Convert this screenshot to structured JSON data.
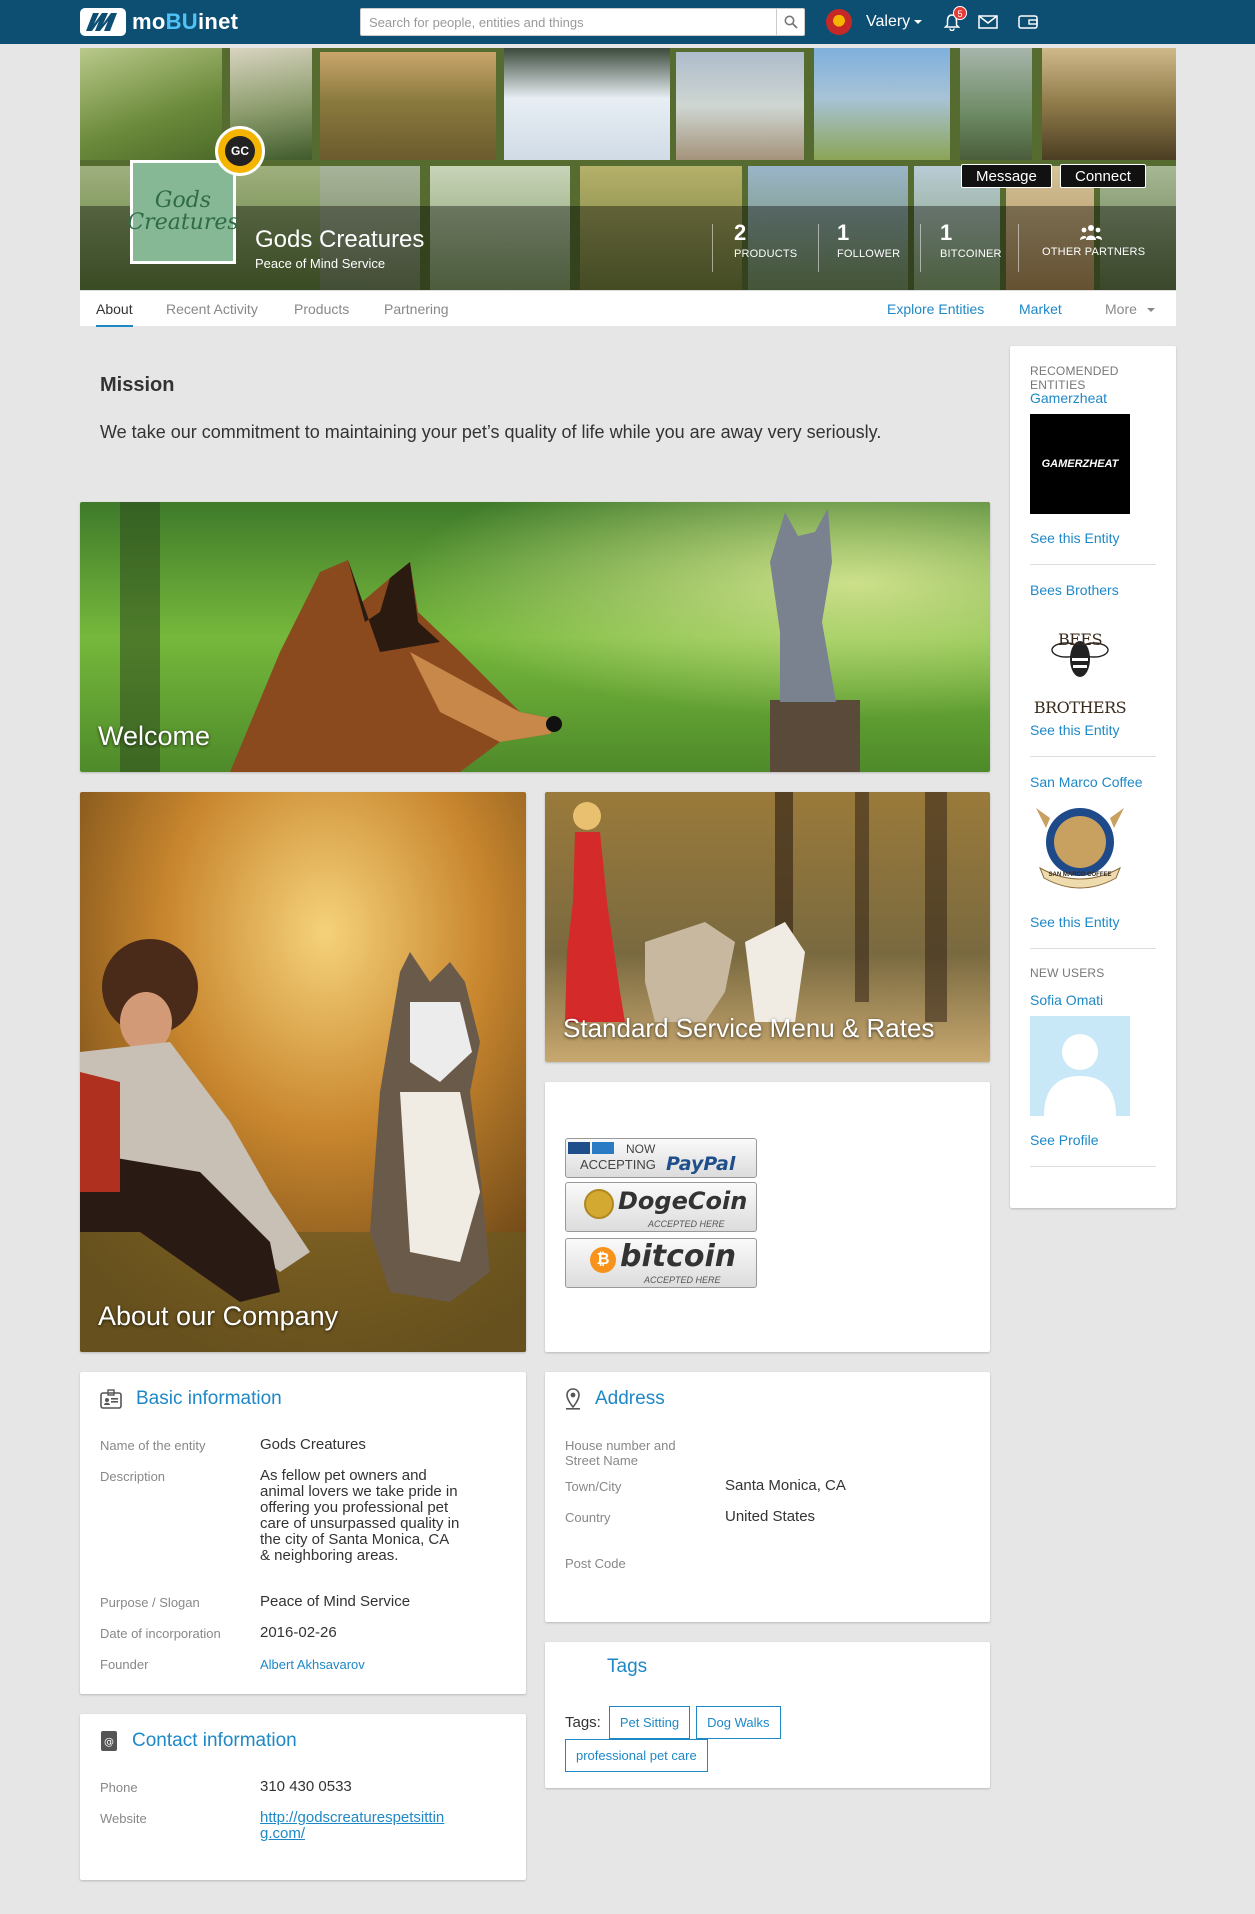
{
  "app": {
    "brand_prefix": "mo",
    "brand_highlight": "BU",
    "brand_suffix": "inet"
  },
  "search": {
    "placeholder": "Search for people, entities and things",
    "value": ""
  },
  "user": {
    "name": "Valery",
    "notification_count": "5"
  },
  "entity": {
    "name": "Gods Creatures",
    "slogan": "Peace of Mind Service",
    "logo_text": "Gods Creatures",
    "emblem_text": "GC"
  },
  "actions": {
    "message": "Message",
    "connect": "Connect"
  },
  "stats": [
    {
      "value": "2",
      "label": "Products"
    },
    {
      "value": "1",
      "label": "Follower"
    },
    {
      "value": "1",
      "label": "Bitcoiner"
    },
    {
      "value": "",
      "label": "Other Partners"
    }
  ],
  "tabs": {
    "about": "About",
    "recent_activity": "Recent Activity",
    "products": "Products",
    "partnering": "Partnering",
    "explore": "Explore Entities",
    "market": "Market",
    "more": "More"
  },
  "mission": {
    "title": "Mission",
    "text": "We take our commitment to maintaining your pet’s quality of life while you are away very seriously."
  },
  "cards": {
    "welcome": "Welcome",
    "about_company": "About our Company",
    "service_menu": "Standard Service Menu & Rates"
  },
  "payments": {
    "paypal_now": "NOW",
    "paypal_accepting": "ACCEPTING",
    "paypal_brand": "PayPal",
    "dogecoin": "DogeCoin",
    "dogecoin_sub": "ACCEPTED HERE",
    "bitcoin": "bitcoin",
    "bitcoin_sub": "ACCEPTED HERE"
  },
  "basic_info": {
    "title": "Basic information",
    "name_label": "Name of the entity",
    "name_value": "Gods Creatures",
    "description_label": "Description",
    "description_value": "As fellow pet owners and animal lovers we take pride in offering you professional pet care of unsurpassed quality in the city of Santa Monica, CA & neighboring areas.",
    "purpose_label": "Purpose / Slogan",
    "purpose_value": "Peace of Mind Service",
    "date_label": "Date of incorporation",
    "date_value": "2016-02-26",
    "founder_label": "Founder",
    "founder_value": "Albert Akhsavarov"
  },
  "address": {
    "title": "Address",
    "house_label": "House number and Street Name",
    "town_label": "Town/City",
    "town_value": "Santa Monica, CA",
    "country_label": "Country",
    "country_value": "United States",
    "post_label": "Post Code"
  },
  "contact": {
    "title": "Contact information",
    "phone_label": "Phone",
    "phone_value": "310 430 0533",
    "website_label": "Website",
    "website_value": "http://godscreaturespetsitting.com/"
  },
  "tags": {
    "title": "Tags",
    "label": "Tags:",
    "items": [
      "Pet Sitting",
      "Dog Walks",
      "professional pet care"
    ]
  },
  "sidebar": {
    "recommended_title": "Recomended Entities",
    "entities": [
      {
        "name": "Gamerzheat",
        "logo_text": "GAMERZHEAT",
        "link": "See this Entity"
      },
      {
        "name": "Bees Brothers",
        "logo_text": "BEES BROTHERS",
        "link": "See this Entity"
      },
      {
        "name": "San Marco Coffee",
        "logo_text": "SAN MARCO COFFEE",
        "link": "See this Entity"
      }
    ],
    "new_users_title": "New Users",
    "new_user": {
      "name": "Sofia Omati",
      "link": "See Profile"
    }
  },
  "colors": {
    "topbar": "#0d4f73",
    "accent": "#1e88c7",
    "background": "#e6e6e6"
  }
}
